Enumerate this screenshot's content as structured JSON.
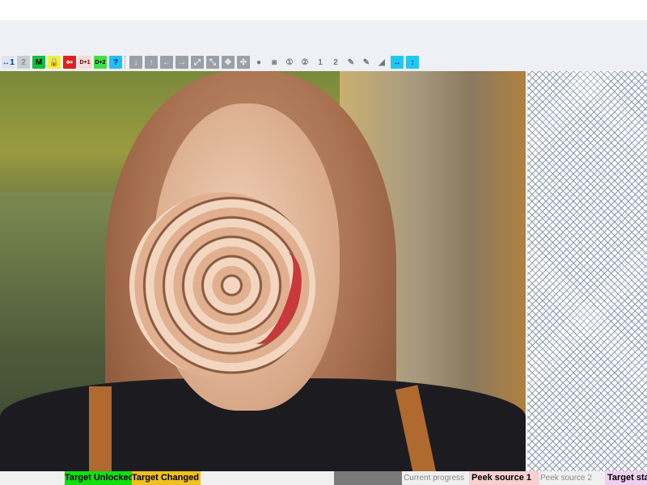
{
  "toolbar": {
    "buttons": [
      {
        "name": "link-source-1-icon",
        "glyph": "↔1",
        "bg": "#dfe4f0",
        "color": "#0030c0"
      },
      {
        "name": "source-2-icon",
        "glyph": "2",
        "bg": "#c8ccd4",
        "color": "#888"
      },
      {
        "name": "mask-icon",
        "glyph": "M",
        "bg": "#10c040",
        "color": "#000"
      },
      {
        "name": "lock-icon",
        "glyph": "🔒",
        "bg": "#f0f040",
        "color": "#000"
      },
      {
        "name": "morph-icon",
        "glyph": "⇐",
        "bg": "#e02020",
        "color": "#fff"
      },
      {
        "name": "d-plus-1-icon",
        "glyph": "D+1",
        "bg": "#f8d8d8",
        "color": "#600"
      },
      {
        "name": "d-plus-2-icon",
        "glyph": "D+2",
        "bg": "#40e040",
        "color": "#000"
      },
      {
        "name": "help-icon",
        "glyph": "?",
        "bg": "#20c0f0",
        "color": "#0020a0"
      }
    ],
    "buttons2": [
      {
        "name": "arrow-down-icon",
        "glyph": "↓"
      },
      {
        "name": "arrow-up-icon",
        "glyph": "↑"
      },
      {
        "name": "arrow-left-icon",
        "glyph": "←"
      },
      {
        "name": "arrow-right-icon",
        "glyph": "→"
      },
      {
        "name": "expand-icon",
        "glyph": "⤢"
      },
      {
        "name": "shrink-icon",
        "glyph": "⤡"
      },
      {
        "name": "expand-all-icon",
        "glyph": "✥"
      },
      {
        "name": "shrink-all-icon",
        "glyph": "✣"
      },
      {
        "name": "dot-icon",
        "glyph": "●"
      },
      {
        "name": "blur-icon",
        "glyph": "◙"
      },
      {
        "name": "point-1-icon",
        "glyph": "①"
      },
      {
        "name": "point-2-icon",
        "glyph": "②"
      },
      {
        "name": "square-1-icon",
        "glyph": "1"
      },
      {
        "name": "square-2-icon",
        "glyph": "2"
      },
      {
        "name": "brush-icon",
        "glyph": "✎"
      },
      {
        "name": "brush-2-icon",
        "glyph": "✎"
      },
      {
        "name": "triangle-icon",
        "glyph": "◢"
      },
      {
        "name": "horizontal-icon",
        "glyph": "↔"
      },
      {
        "name": "vertical-icon",
        "glyph": "↕"
      }
    ]
  },
  "status": {
    "unlocked": "Target Unlocked",
    "changed": "Target Changed",
    "progress_label": "Current progress",
    "progress": 0,
    "peek1": "Peek source 1",
    "peek2": "Peek source 2",
    "target_state": "Target state"
  }
}
